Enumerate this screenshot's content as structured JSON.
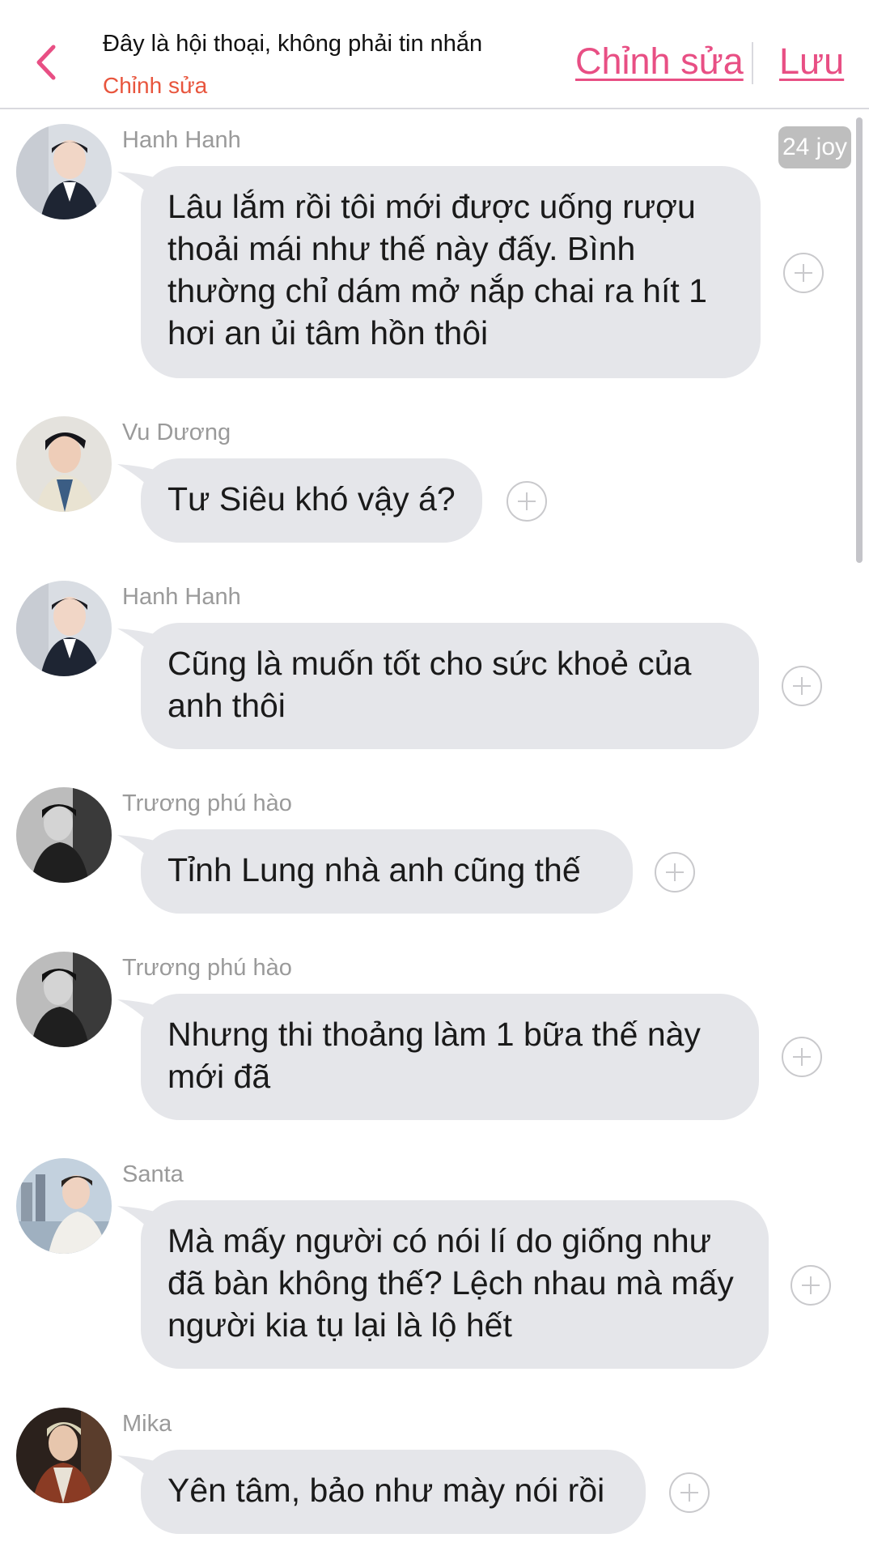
{
  "header": {
    "title": "Đây là hội thoại, không phải tin nhắn",
    "subtitle": "Chỉnh sửa",
    "edit_label": "Chỉnh sửa",
    "save_label": "Lưu"
  },
  "badge": {
    "text": "24 joy"
  },
  "messages": [
    {
      "sender": "Hanh Hanh",
      "text": "Lâu lắm rồi tôi mới được uống rượu thoải mái như thế này đấy. Bình thường chỉ dám mở nắp chai ra hít 1 hơi an ủi tâm hồn thôi",
      "avatar": "avatar-hanh-hanh"
    },
    {
      "sender": "Vu Dương",
      "text": "Tư Siêu khó vậy á?",
      "avatar": "avatar-vu-duong"
    },
    {
      "sender": "Hanh Hanh",
      "text": "Cũng là muốn tốt cho sức khoẻ của anh thôi",
      "avatar": "avatar-hanh-hanh"
    },
    {
      "sender": "Trương phú hào",
      "text": "Tỉnh Lung nhà anh cũng thế",
      "avatar": "avatar-truong-phu-hao"
    },
    {
      "sender": "Trương phú hào",
      "text": "Nhưng thi thoảng làm 1 bữa thế này mới đã",
      "avatar": "avatar-truong-phu-hao"
    },
    {
      "sender": "Santa",
      "text": "Mà mấy người có nói lí do giống như đã bàn không thế? Lệch nhau mà mấy người kia tụ lại là lộ hết",
      "avatar": "avatar-santa"
    },
    {
      "sender": "Mika",
      "text": "Yên tâm, bảo như mày nói rồi",
      "avatar": "avatar-mika"
    }
  ],
  "colors": {
    "accent_pink": "#e84f84",
    "subtitle_orange": "#e8553d",
    "bubble_bg": "#e5e6ea"
  }
}
